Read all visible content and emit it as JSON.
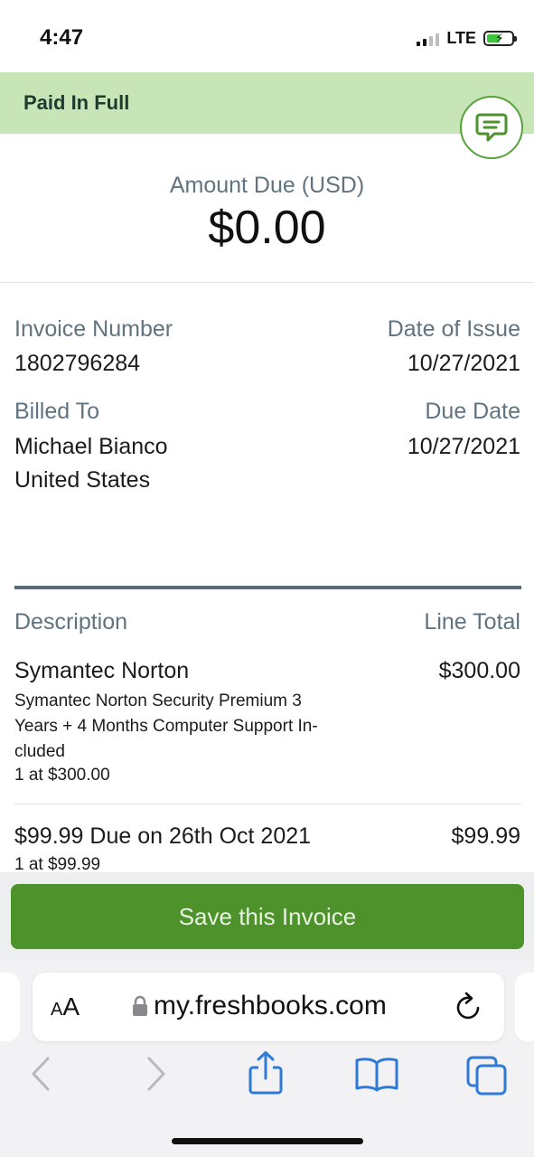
{
  "status_bar": {
    "time": "4:47",
    "network": "LTE"
  },
  "banner": {
    "status": "Paid In Full"
  },
  "icons": {
    "chat": "chat-bubble-icon",
    "lock": "lock-icon",
    "reload": "reload-icon",
    "back": "chevron-left-icon",
    "forward": "chevron-right-icon",
    "share": "share-icon",
    "bookmarks": "book-icon",
    "tabs": "tabs-icon"
  },
  "amount": {
    "label": "Amount Due (USD)",
    "value": "$0.00"
  },
  "invoice": {
    "number_label": "Invoice Number",
    "number": "1802796284",
    "issue_label": "Date of Issue",
    "issue_date": "10/27/2021",
    "billed_label": "Billed To",
    "billed_name": "Michael Bianco",
    "billed_country": "United States",
    "due_label": "Due Date",
    "due_date": "10/27/2021"
  },
  "items": {
    "description_header": "Description",
    "total_header": "Line Total",
    "rows": [
      {
        "name": "Symantec Norton",
        "description_lines": [
          "Symantec Norton Security Premium 3",
          "Years + 4 Months Computer Support In-",
          "cluded"
        ],
        "qty": "1 at $300.00",
        "total": "$300.00"
      },
      {
        "name": "$99.99 Due on 26th Oct 2021",
        "qty": "1 at $99.99",
        "total": "$99.99"
      }
    ]
  },
  "actions": {
    "save_label": "Save this Invoice"
  },
  "browser": {
    "text_size_small": "A",
    "text_size_large": "A",
    "url": "my.freshbooks.com"
  },
  "colors": {
    "paid_banner": "#c7e5b7",
    "accent_green": "#4e922c",
    "label_gray": "#5f7380",
    "ios_blue": "#2f7ad8"
  }
}
